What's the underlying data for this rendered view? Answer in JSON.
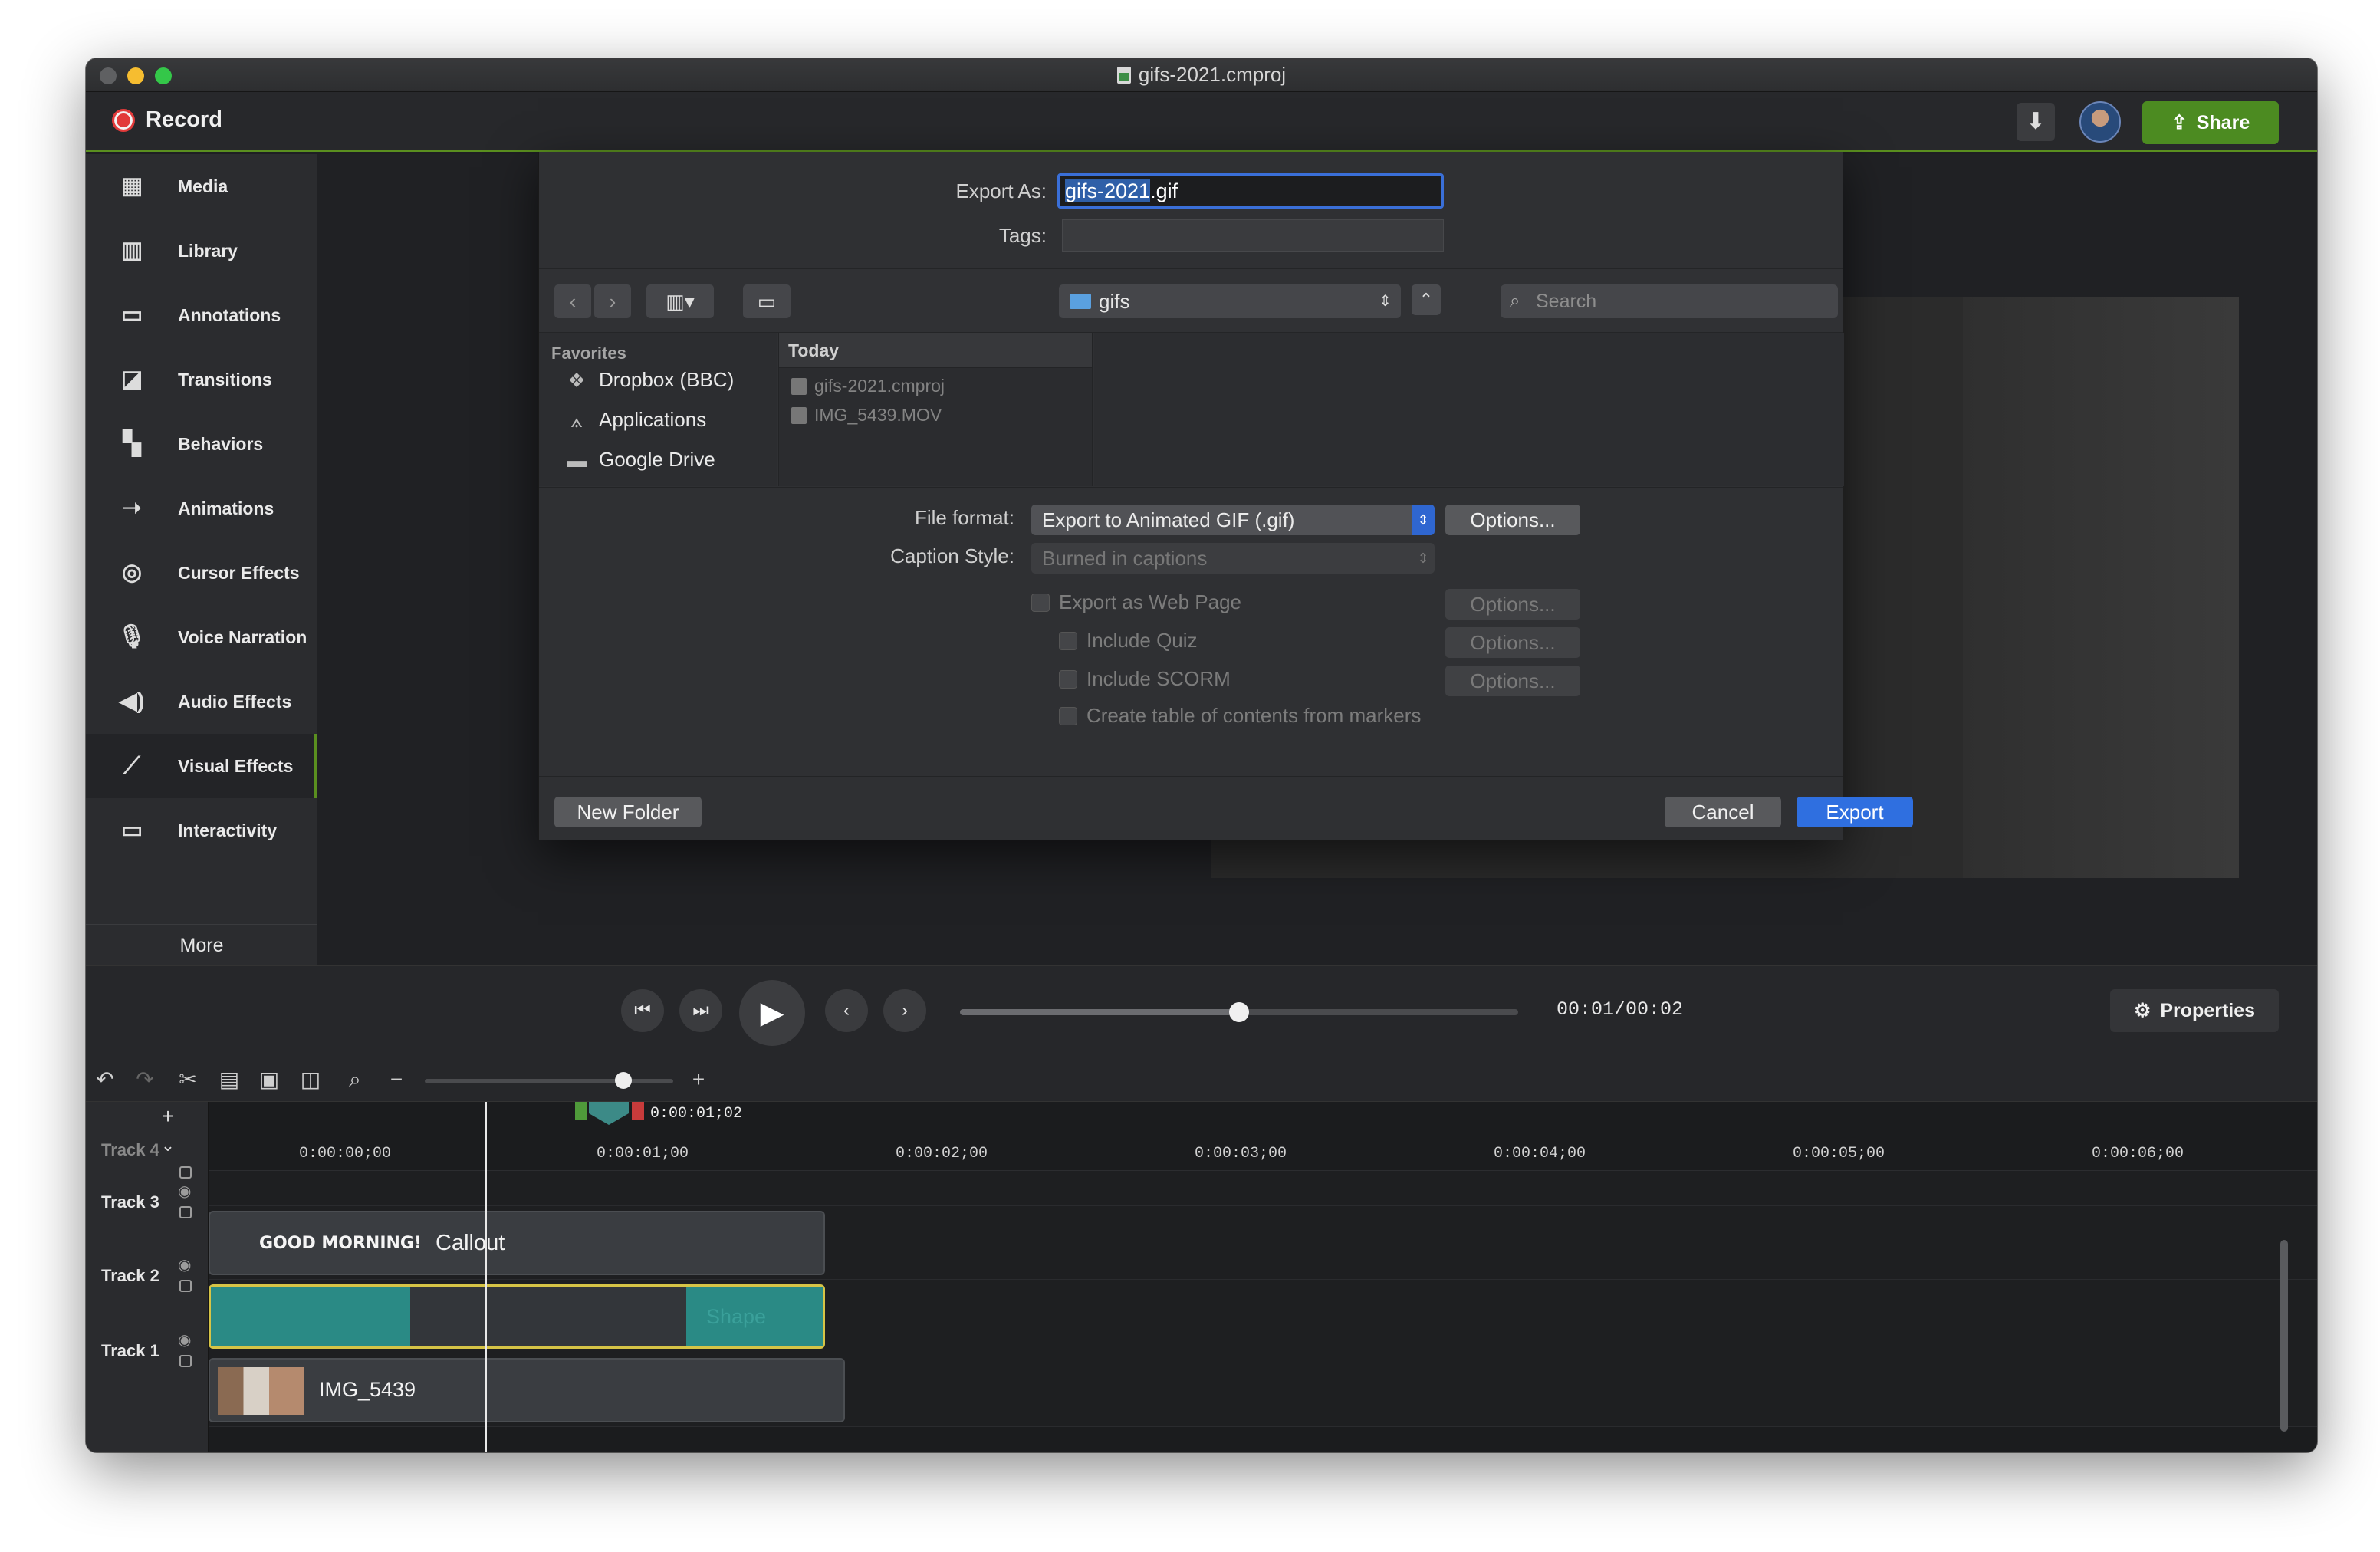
{
  "window": {
    "title": "gifs-2021.cmproj"
  },
  "topbar": {
    "record_label": "Record",
    "share_label": "Share"
  },
  "sidebar": {
    "items": [
      {
        "label": "Media",
        "icon": "media-icon"
      },
      {
        "label": "Library",
        "icon": "library-icon"
      },
      {
        "label": "Annotations",
        "icon": "annotations-icon"
      },
      {
        "label": "Transitions",
        "icon": "transitions-icon"
      },
      {
        "label": "Behaviors",
        "icon": "behaviors-icon"
      },
      {
        "label": "Animations",
        "icon": "animations-icon"
      },
      {
        "label": "Cursor Effects",
        "icon": "cursor-effects-icon"
      },
      {
        "label": "Voice Narration",
        "icon": "microphone-icon"
      },
      {
        "label": "Audio Effects",
        "icon": "speaker-icon"
      },
      {
        "label": "Visual Effects",
        "icon": "magic-wand-icon"
      },
      {
        "label": "Interactivity",
        "icon": "interactivity-icon"
      }
    ],
    "active": "Visual Effects",
    "more_label": "More"
  },
  "dialog": {
    "export_as_label": "Export As:",
    "export_as_value_selected": "gifs-2021",
    "export_as_value_ext": ".gif",
    "tags_label": "Tags:",
    "folder": "gifs",
    "search_placeholder": "Search",
    "favorites_title": "Favorites",
    "favorites": [
      "Dropbox (BBC)",
      "Applications",
      "Google Drive"
    ],
    "today_header": "Today",
    "files": [
      "gifs-2021.cmproj",
      "IMG_5439.MOV"
    ],
    "file_format_label": "File format:",
    "file_format_value": "Export to Animated GIF (.gif)",
    "caption_style_label": "Caption Style:",
    "caption_style_value": "Burned in captions",
    "options_label": "Options...",
    "checkboxes": [
      "Export as Web Page",
      "Include Quiz",
      "Include SCORM",
      "Create table of contents from markers"
    ],
    "new_folder_label": "New Folder",
    "cancel_label": "Cancel",
    "export_label": "Export"
  },
  "playback": {
    "timecode": "00:01/00:02",
    "progress_fraction": 0.5,
    "properties_label": "Properties"
  },
  "timeline": {
    "playhead_time": "0:00:01;02",
    "ruler_labels": [
      "0:00:00;00",
      "0:00:01;00",
      "0:00:02;00",
      "0:00:03;00",
      "0:00:04;00",
      "0:00:05;00",
      "0:00:06;00"
    ],
    "tracks": [
      "Track 4",
      "Track 3",
      "Track 2",
      "Track 1"
    ],
    "callout_text": "GOOD MORNING!",
    "callout_label": "Callout",
    "shape_label": "Shape",
    "video_label": "IMG_5439"
  },
  "colors": {
    "accent_green": "#5a8f1f",
    "export_blue": "#2f6fe0",
    "record_red": "#e23a3a",
    "clip_teal": "#2a8a85"
  }
}
